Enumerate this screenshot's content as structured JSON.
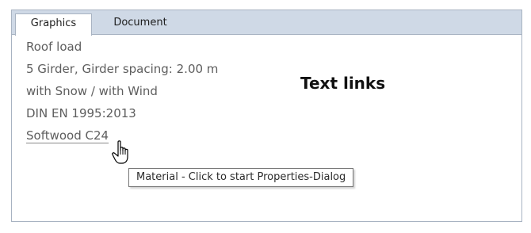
{
  "tabs": [
    {
      "label": "Graphics",
      "active": true
    },
    {
      "label": "Document",
      "active": false
    }
  ],
  "content": {
    "lines": [
      "Roof load",
      "5 Girder, Girder spacing: 2.00 m",
      "with Snow / with Wind",
      "DIN EN 1995:2013"
    ],
    "material_link": "Softwood C24",
    "heading": "Text links"
  },
  "tooltip": {
    "text": "Material - Click to start Properties-Dialog"
  },
  "cursor": {
    "icon": "hand-pointer-icon"
  },
  "colors": {
    "tabbar_bg": "#cfd9e6",
    "border": "#a8b3c2",
    "body_text": "#5e5e5e",
    "heading_text": "#111111"
  }
}
